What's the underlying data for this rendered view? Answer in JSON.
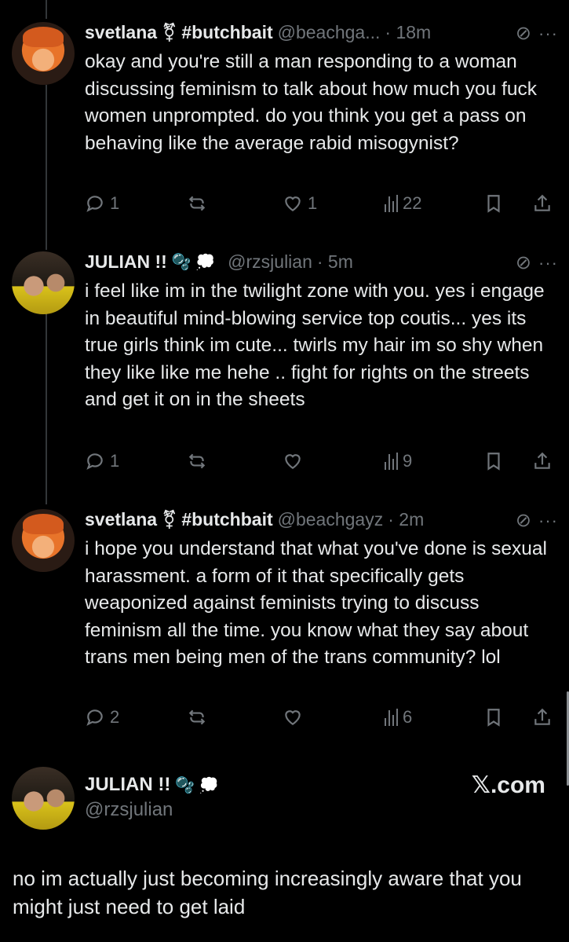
{
  "tweets": [
    {
      "name": "svetlana",
      "symbol": "⚧",
      "tag": "#butchbait",
      "handle": "@beachga...",
      "time": "· 18m",
      "text": "okay and you're still a man responding to a woman discussing feminism to talk about how much you fuck women unprompted. do you think you get a pass on behaving like the average rabid misogynist?",
      "replies": "1",
      "reposts": "",
      "likes": "1",
      "views": "22"
    },
    {
      "name": "JULIAN !!",
      "emoji": "🫧 💭",
      "handle": "@rzsjulian",
      "time": "· 5m",
      "text": "i feel like im in the twilight zone with you. yes i engage in beautiful mind-blowing service top coutis... yes its true girls think im cute... twirls my hair   im so shy when they like like me hehe .. fight for rights on the streets and get it on in the sheets",
      "replies": "1",
      "reposts": "",
      "likes": "",
      "views": "9"
    },
    {
      "name": "svetlana",
      "symbol": "⚧",
      "tag": "#butchbait",
      "handle": "@beachgayz",
      "time": "· 2m",
      "text": "i hope you understand that what you've done is sexual harassment. a form of it that specifically gets weaponized against feminists trying to discuss feminism all the time. you know what they say about trans men being men of the trans community? lol",
      "replies": "2",
      "reposts": "",
      "likes": "",
      "views": "6"
    }
  ],
  "card": {
    "name": "JULIAN !!",
    "emoji": "🫧 💭",
    "handle": "@rzsjulian",
    "brand": "𝕏.com",
    "text": "no im actually just becoming increasingly aware that you might just need to get laid"
  },
  "icons": {
    "grok": "slashed-circle-icon",
    "more": "more-icon",
    "reply": "reply-icon",
    "repost": "repost-icon",
    "like": "heart-icon",
    "views": "views-icon",
    "bookmark": "bookmark-icon",
    "share": "share-icon"
  },
  "colors": {
    "background": "#000000",
    "text": "#e7e9ea",
    "muted": "#71767b"
  }
}
